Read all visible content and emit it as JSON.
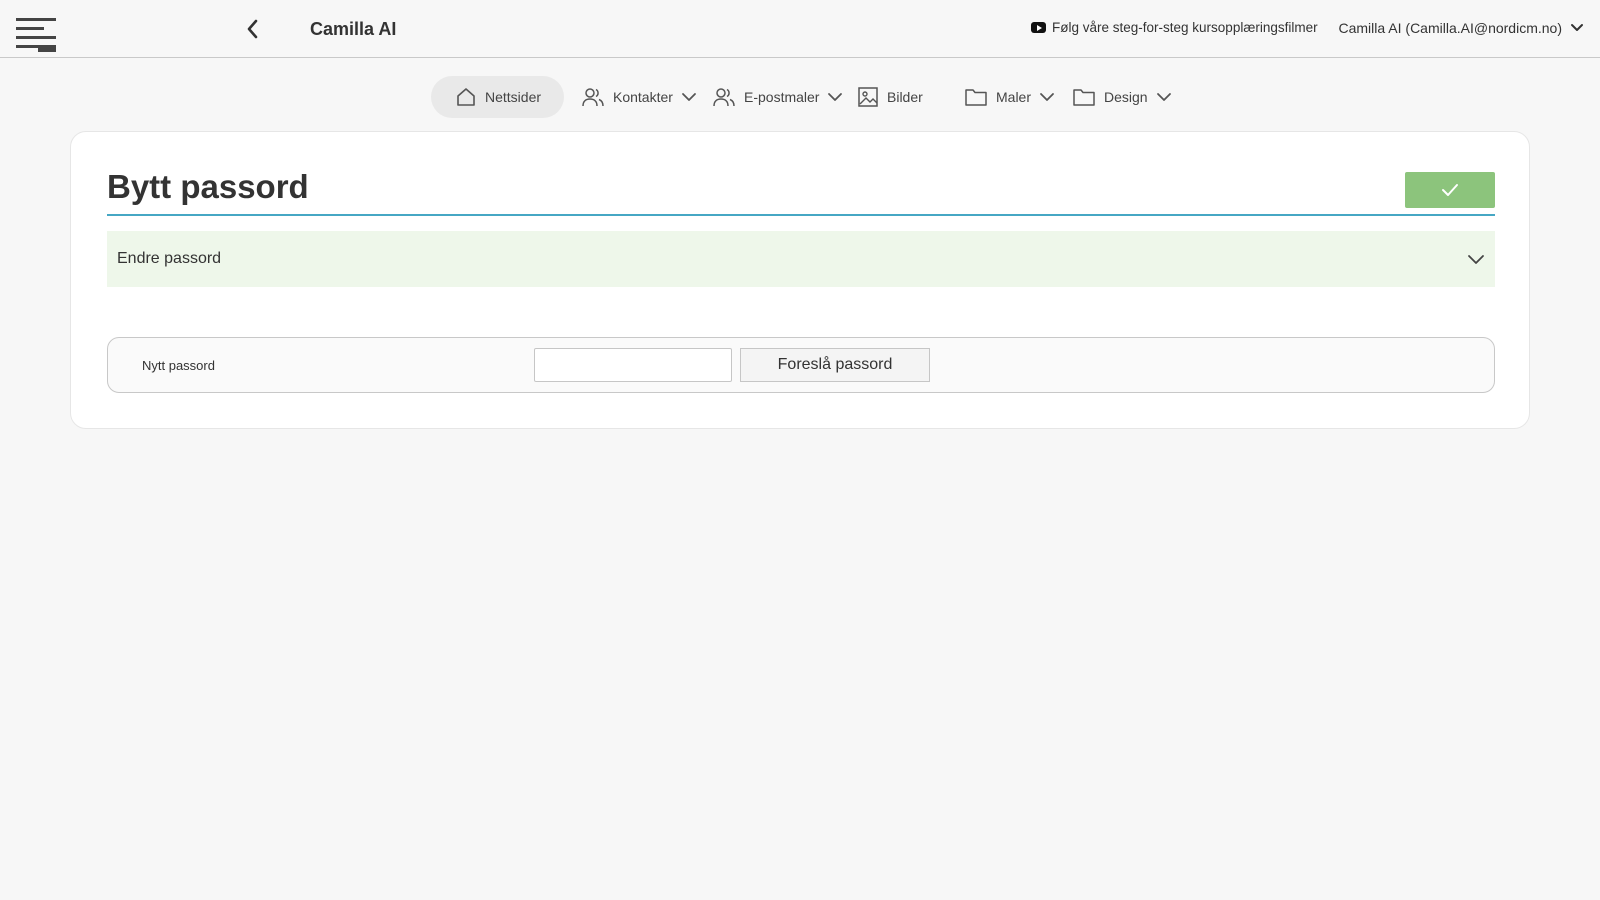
{
  "header": {
    "app_title": "Camilla AI",
    "video_link": "Følg våre steg-for-steg kursopplæringsfilmer",
    "user": "Camilla AI (Camilla.AI@nordicm.no)"
  },
  "nav": {
    "items": [
      {
        "label": "Nettsider",
        "icon": "home-icon",
        "active": true
      },
      {
        "label": "Kontakter",
        "icon": "users-icon",
        "dropdown": true
      },
      {
        "label": "E-postmaler",
        "icon": "users-icon",
        "dropdown": true
      },
      {
        "label": "Bilder",
        "icon": "image-icon"
      },
      {
        "label": "Maler",
        "icon": "folder-icon",
        "dropdown": true
      },
      {
        "label": "Design",
        "icon": "folder-icon",
        "dropdown": true
      }
    ]
  },
  "main": {
    "title": "Bytt passord",
    "accordion_label": "Endre passord",
    "field_label": "Nytt passord",
    "password_value": "",
    "suggest_label": "Foreslå passord"
  },
  "colors": {
    "accent_line": "#46a7c4",
    "save_button": "#8cc47c",
    "accordion_bg": "#eef7ea"
  }
}
